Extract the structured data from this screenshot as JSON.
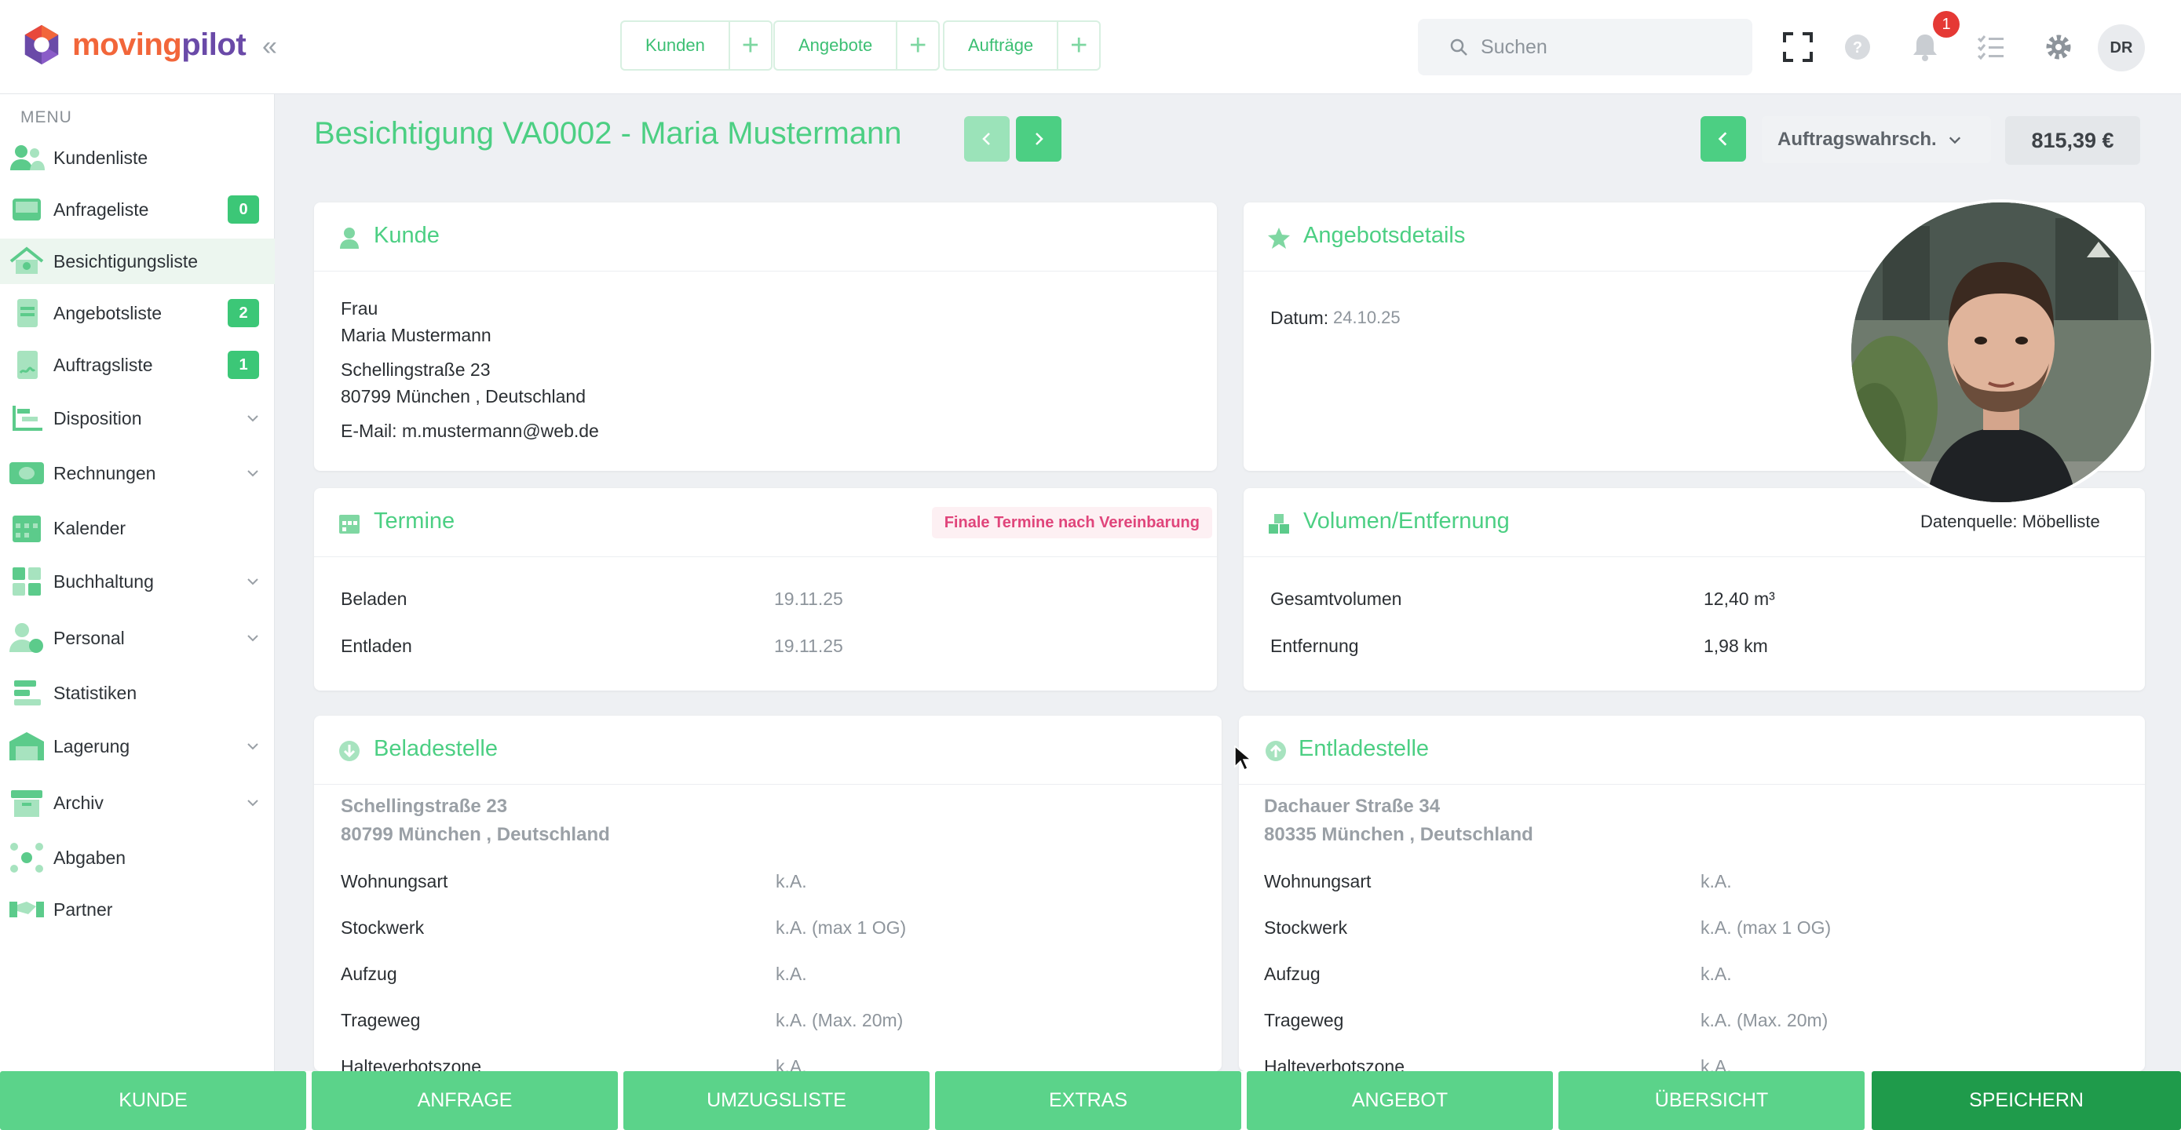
{
  "brand": {
    "name_part1": "moving",
    "name_part2": "pilot"
  },
  "quick_actions": [
    {
      "label": "Kunden"
    },
    {
      "label": "Angebote"
    },
    {
      "label": "Aufträge"
    }
  ],
  "search": {
    "placeholder": "Suchen"
  },
  "notifications": {
    "count": "1"
  },
  "user": {
    "initials": "DR"
  },
  "sidebar": {
    "menu_title": "MENU",
    "items": [
      {
        "label": "Kundenliste",
        "icon": "users-icon"
      },
      {
        "label": "Anfrageliste",
        "icon": "inbox-icon",
        "badge": "0"
      },
      {
        "label": "Besichtigungsliste",
        "icon": "house-icon",
        "active": true
      },
      {
        "label": "Angebotsliste",
        "icon": "document-icon",
        "badge": "2"
      },
      {
        "label": "Auftragsliste",
        "icon": "contract-icon",
        "badge": "1"
      },
      {
        "label": "Disposition",
        "icon": "gantt-icon",
        "expandable": true
      },
      {
        "label": "Rechnungen",
        "icon": "money-icon",
        "expandable": true
      },
      {
        "label": "Kalender",
        "icon": "calendar-icon"
      },
      {
        "label": "Buchhaltung",
        "icon": "calculator-icon",
        "expandable": true
      },
      {
        "label": "Personal",
        "icon": "person-clock-icon",
        "expandable": true
      },
      {
        "label": "Statistiken",
        "icon": "bars-icon"
      },
      {
        "label": "Lagerung",
        "icon": "warehouse-icon",
        "expandable": true
      },
      {
        "label": "Archiv",
        "icon": "archive-icon",
        "expandable": true
      },
      {
        "label": "Abgaben",
        "icon": "network-icon"
      },
      {
        "label": "Partner",
        "icon": "handshake-icon"
      }
    ]
  },
  "header": {
    "title": "Besichtigung VA0002 - Maria Mustermann",
    "status": "Auftragswahrsch.",
    "price": "815,39 €"
  },
  "kunde": {
    "title": "Kunde",
    "salutation": "Frau",
    "name": "Maria Mustermann",
    "street": "Schellingstraße 23",
    "city": "80799 München , Deutschland",
    "email": "E-Mail: m.mustermann@web.de"
  },
  "angebot": {
    "title": "Angebotsdetails",
    "date_label": "Datum:",
    "date_value": "24.10.25"
  },
  "termine": {
    "title": "Termine",
    "tag": "Finale Termine nach Vereinbarung",
    "rows": [
      {
        "label": "Beladen",
        "value": "19.11.25"
      },
      {
        "label": "Entladen",
        "value": "19.11.25"
      }
    ]
  },
  "volumen": {
    "title": "Volumen/Entfernung",
    "source": "Datenquelle: Möbelliste",
    "rows": [
      {
        "label": "Gesamtvolumen",
        "value": "12,40 m³"
      },
      {
        "label": "Entfernung",
        "value": "1,98 km"
      }
    ]
  },
  "beladestelle": {
    "title": "Beladestelle",
    "street": "Schellingstraße 23",
    "city": "80799 München , Deutschland",
    "rows": [
      {
        "label": "Wohnungsart",
        "value": "k.A."
      },
      {
        "label": "Stockwerk",
        "value": "k.A. (max 1 OG)"
      },
      {
        "label": "Aufzug",
        "value": "k.A."
      },
      {
        "label": "Trageweg",
        "value": "k.A. (Max. 20m)"
      },
      {
        "label": "Halteverbotszone",
        "value": "k.A."
      }
    ]
  },
  "entladestelle": {
    "title": "Entladestelle",
    "street": "Dachauer Straße 34",
    "city": "80335 München , Deutschland",
    "rows": [
      {
        "label": "Wohnungsart",
        "value": "k.A."
      },
      {
        "label": "Stockwerk",
        "value": "k.A. (max 1 OG)"
      },
      {
        "label": "Aufzug",
        "value": "k.A."
      },
      {
        "label": "Trageweg",
        "value": "k.A. (Max. 20m)"
      },
      {
        "label": "Halteverbotszone",
        "value": "k.A."
      }
    ]
  },
  "bottom_tabs": [
    "KUNDE",
    "ANFRAGE",
    "UMZUGSLISTE",
    "EXTRAS",
    "ANGEBOT",
    "ÜBERSICHT",
    "SPEICHERN"
  ],
  "colors": {
    "accent": "#4ccf83",
    "badge": "#3cc777",
    "save": "#1f9b4b",
    "tab": "#5bd38a"
  }
}
